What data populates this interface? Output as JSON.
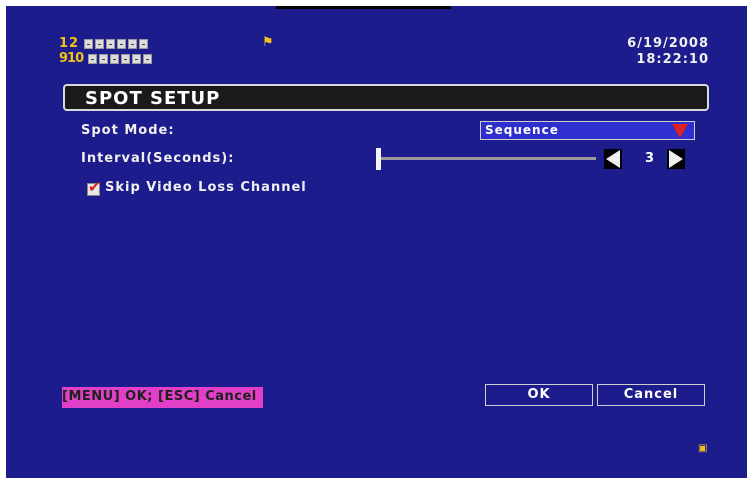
{
  "top_status": {
    "row1_channels": "12",
    "row2_channels": "910",
    "status_icon": "alarm-flag-icon",
    "date": "6/19/2008",
    "time": "18:22:10"
  },
  "dialog": {
    "title": "SPOT SETUP"
  },
  "settings": {
    "spot_mode_label": "Spot Mode:",
    "spot_mode_value": "Sequence",
    "interval_label": "Interval(Seconds):",
    "interval_value": "3",
    "skip_label": "Skip Video Loss Channel",
    "skip_checked": true
  },
  "footer": {
    "hint": "[MENU] OK; [ESC] Cancel",
    "ok_label": "OK",
    "cancel_label": "Cancel"
  },
  "colors": {
    "background": "#1c1c8c",
    "accent_yellow": "#f2c21b",
    "dropdown_arrow": "#e02020",
    "hint_bg": "#e040c8"
  }
}
